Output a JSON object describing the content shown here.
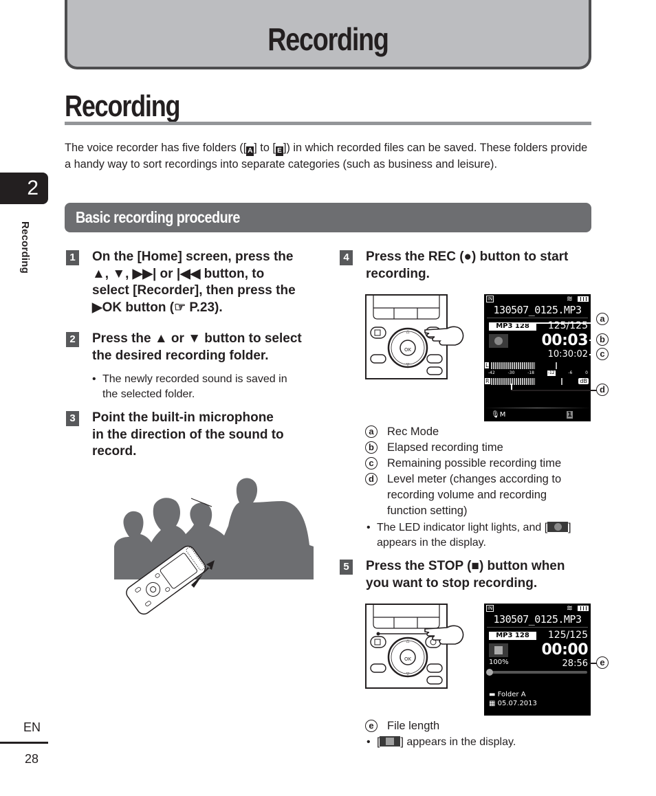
{
  "chapter_banner": {
    "title": "Recording"
  },
  "section": {
    "title": "Recording"
  },
  "intro": {
    "part1": "The voice recorder has five folders (",
    "folder_first": "A",
    "part2": " to ",
    "folder_last": "E",
    "part3": ") in which recorded files can be saved. These folders provide a handy way to sort recordings into separate categories (such as business and leisure)."
  },
  "side": {
    "chapter_number": "2",
    "chapter_label": "Recording",
    "language": "EN",
    "page_number": "28"
  },
  "subsection": {
    "title": "Basic recording procedure"
  },
  "steps": [
    {
      "number": "1",
      "lines": [
        "On the [Home] screen, press the",
        "▲, ▼, ▶▶| or |◀◀ button, to",
        "select [Recorder], then press the",
        "▶OK button (☞ P.23)."
      ]
    },
    {
      "number": "2",
      "lines": [
        "Press the ▲ or ▼ button to select",
        "the desired recording folder."
      ],
      "bullets": [
        [
          "The newly recorded sound is saved in",
          "the selected folder."
        ]
      ]
    },
    {
      "number": "3",
      "lines": [
        "Point the built-in microphone",
        "in the direction of the sound to",
        "record."
      ]
    },
    {
      "number": "4",
      "lines": [
        "Press the REC (●) button to start",
        "recording."
      ]
    },
    {
      "number": "5",
      "lines": [
        "Press the STOP (■) button when",
        "you want to stop recording."
      ]
    }
  ],
  "step4_legend": [
    {
      "key": "a",
      "text": "Rec Mode"
    },
    {
      "key": "b",
      "text": "Elapsed recording time"
    },
    {
      "key": "c",
      "text": "Remaining possible recording time"
    },
    {
      "key": "d",
      "text": "Level meter (changes according to",
      "text2": "recording volume and recording",
      "text3": "function setting)"
    }
  ],
  "step4_note": {
    "prefix": "The LED indicator light lights, and [",
    "suffix": "]",
    "line2": "appears in the display."
  },
  "step5_legend": [
    {
      "key": "e",
      "text": "File length"
    }
  ],
  "step5_note": {
    "prefix": "[",
    "suffix": "] appears in the display."
  },
  "lcd_recording": {
    "memory_icon": "IN",
    "filename": "130507_0125.MP3",
    "rec_mode": "MP3 128",
    "file_count": "125/125",
    "elapsed": "00:03",
    "remaining": "10:30:02",
    "level_left_label": "L",
    "level_right_label": "R",
    "db_scale": [
      "-42",
      "-30",
      "-18",
      "-12",
      "-6",
      "0"
    ],
    "db_unit": "dB",
    "mic_mode": "M",
    "folder_badge": "1"
  },
  "lcd_stopped": {
    "memory_icon": "IN",
    "filename": "130507_0125.MP3",
    "rec_mode": "MP3 128",
    "file_count": "125/125",
    "elapsed": "00:00",
    "percent": "100%",
    "file_length": "28:56",
    "playback_position": 0.0,
    "folder": "Folder A",
    "date": "05.07.2013"
  },
  "device_buttons": {
    "ok_label": "OK"
  }
}
